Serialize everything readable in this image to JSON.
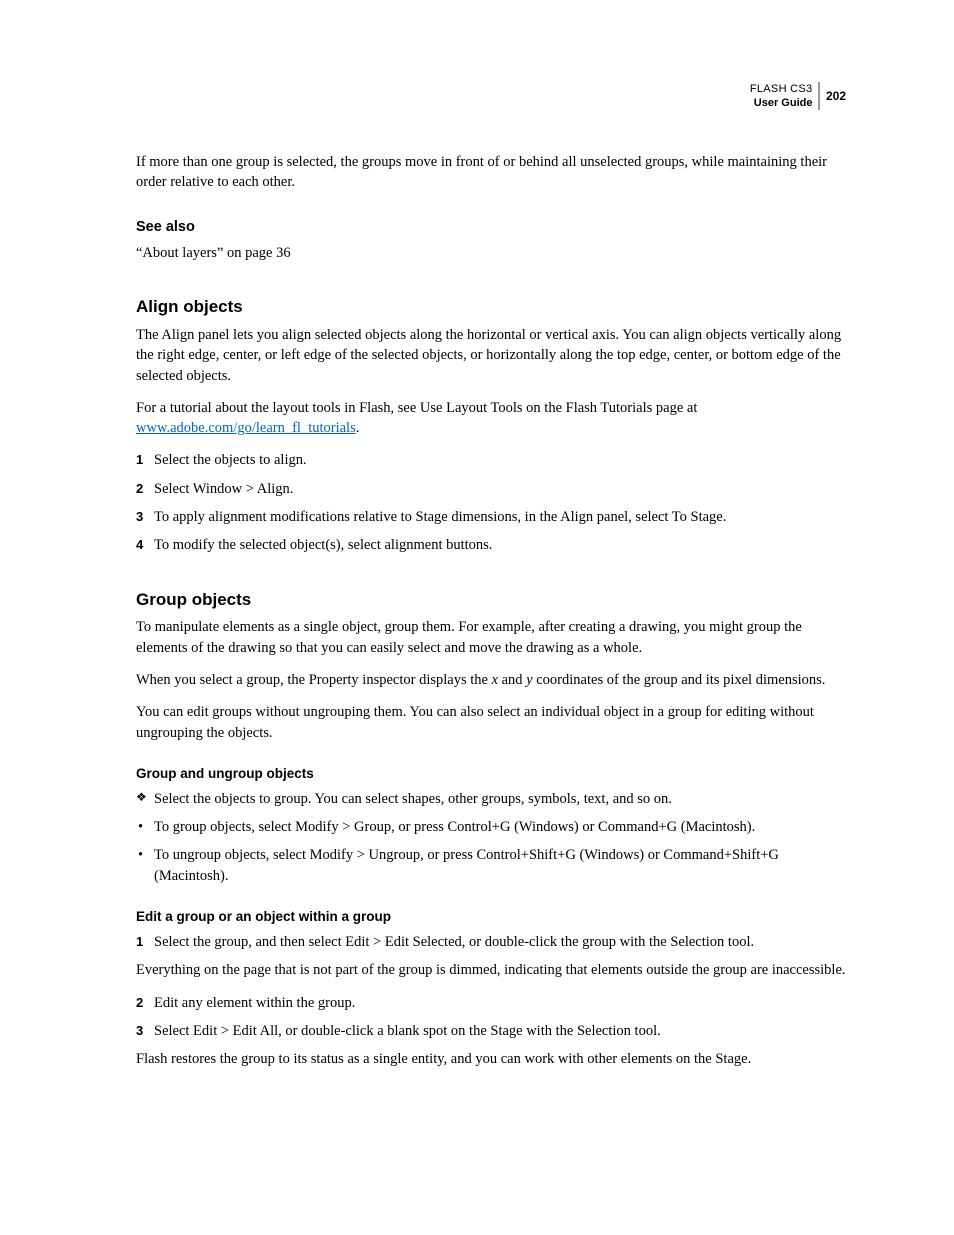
{
  "header": {
    "product": "FLASH CS3",
    "guide": "User Guide",
    "page": "202"
  },
  "intro_para": "If more than one group is selected, the groups move in front of or behind all unselected groups, while maintaining their order relative to each other.",
  "see_also": {
    "heading": "See also",
    "ref": "“About layers” on page 36"
  },
  "align": {
    "heading": "Align objects",
    "para1": "The Align panel lets you align selected objects along the horizontal or vertical axis. You can align objects vertically along the right edge, center, or left edge of the selected objects, or horizontally along the top edge, center, or bottom edge of the selected objects.",
    "para2_pre": "For a tutorial about the layout tools in Flash, see Use Layout Tools on the Flash Tutorials page at ",
    "para2_link": "www.adobe.com/go/learn_fl_tutorials",
    "para2_post": ".",
    "steps": [
      "Select the objects to align.",
      "Select Window > Align.",
      "To apply alignment modifications relative to Stage dimensions, in the Align panel, select To Stage.",
      "To modify the selected object(s), select alignment buttons."
    ]
  },
  "group": {
    "heading": "Group objects",
    "para1": "To manipulate elements as a single object, group them. For example, after creating a drawing, you might group the elements of the drawing so that you can easily select and move the drawing as a whole.",
    "para2_pre": "When you select a group, the Property inspector displays the ",
    "para2_x": "x",
    "para2_mid": " and ",
    "para2_y": "y",
    "para2_post": " coordinates of the group and its pixel dimensions.",
    "para3": "You can edit groups without ungrouping them. You can also select an individual object in a group for editing without ungrouping the objects.",
    "sub1": {
      "heading": "Group and ungroup objects",
      "diamond": "Select the objects to group. You can select shapes, other groups, symbols, text, and so on.",
      "bullets": [
        "To group objects, select Modify > Group, or press Control+G (Windows) or Command+G (Macintosh).",
        "To ungroup objects, select Modify > Ungroup, or press Control+Shift+G (Windows) or Command+Shift+G (Macintosh)."
      ]
    },
    "sub2": {
      "heading": "Edit a group or an object within a group",
      "step1": "Select the group, and then select Edit > Edit Selected, or double-click the group with the Selection tool.",
      "after1": "Everything on the page that is not part of the group is dimmed, indicating that elements outside the group are inaccessible.",
      "step2": "Edit any element within the group.",
      "step3": "Select Edit > Edit All, or double-click a blank spot on the Stage with the Selection tool.",
      "after3": "Flash restores the group to its status as a single entity, and you can work with other elements on the Stage."
    }
  },
  "markers": {
    "n1": "1",
    "n2": "2",
    "n3": "3",
    "n4": "4",
    "diamond": "❖",
    "bullet": "•"
  }
}
